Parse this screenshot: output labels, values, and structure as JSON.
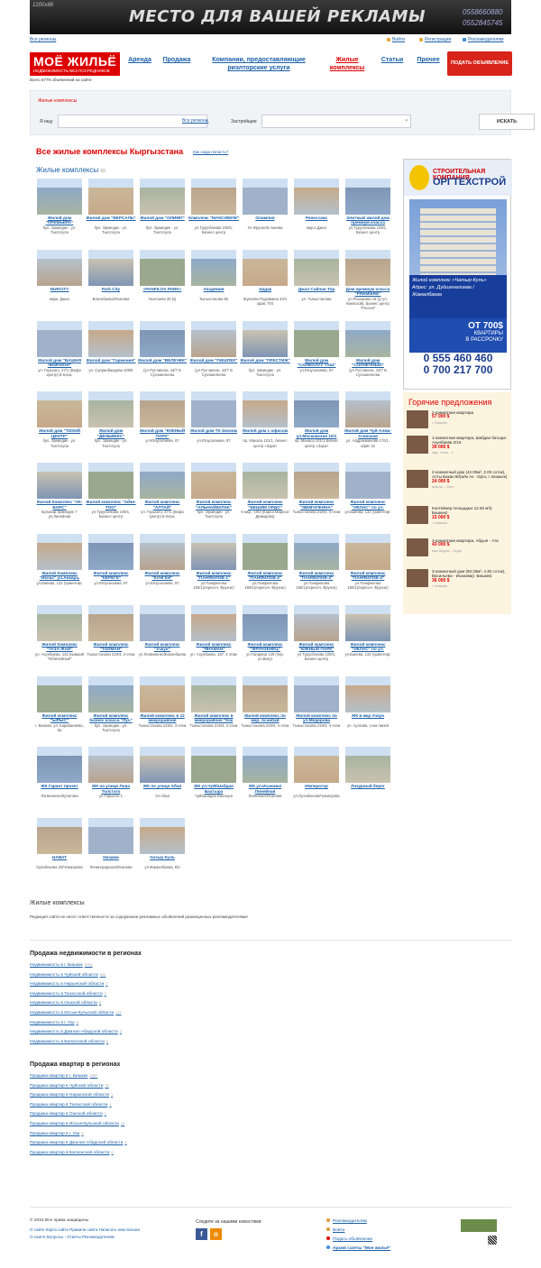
{
  "banner": {
    "dims": "1200x88",
    "text": "МЕСТО ДЛЯ ВАШЕЙ РЕКЛАМЫ",
    "phone1": "0558660880",
    "phone2": "0552845745"
  },
  "toplinks": {
    "regions": "Все регионы",
    "login": "Войти",
    "register": "Регистрация",
    "advertisers": "Рекламодателям"
  },
  "logo": {
    "title": "МОЁ ЖИЛЬЁ",
    "subtitle": "НЕДВИЖИМОСТЬ БЕЗ ПОСРЕДНИКОВ"
  },
  "count": "Всего 6779 объявлений на сайте",
  "nav": {
    "rent": "Аренда",
    "sale": "Продажа",
    "companies": "Компании, предоставляющие риэлторские услуги",
    "complexes": "Жилые комплексы",
    "articles": "Статьи",
    "other": "Прочее",
    "post": "ПОДАТЬ ОБЪЯВЛЕНИЕ"
  },
  "search": {
    "crumb": "Жилые комплексы",
    "ilook": "Я ищу",
    "all_regions": "Все регионы",
    "developer": "Застройщик:",
    "button": "ИСКАТЬ"
  },
  "heading": "Все жилые комплексы Кыргызстана",
  "howto": "Как сюда попасть?",
  "subheading": "Жилые комплексы",
  "subcount": "65",
  "complexes": [
    {
      "name": "Жилой дом \"ПРЕМЬЕРА\"",
      "addr": "бул. Эркиндик - ул. Тыктогула"
    },
    {
      "name": "Жилой дом \"ВЕРСАЛЬ\"",
      "addr": "бул. Эркиндик - ул. Тыктогула"
    },
    {
      "name": "Жилой дом \"ОЛИМП\"",
      "addr": "бул. Эркиндик - ул. Тыктогула"
    },
    {
      "name": "Комплекс \"МАКСИМУМ\"",
      "addr": "ул.Турусбекова 109/1, Бизнес центр"
    },
    {
      "name": "Олимпия",
      "addr": "Ул.Фрунзе/К.Акиева"
    },
    {
      "name": "Ренессанс",
      "addr": "мкр.н.Джал"
    },
    {
      "name": "Элитный жилой дом премиум класса",
      "addr": "ул.Турусбекова 109/1, Бизнес центр"
    },
    {
      "name": "NURCITY",
      "addr": "мкрн. Джал"
    },
    {
      "name": "Park City",
      "addr": "Боконбаева/Исанова"
    },
    {
      "name": "«PANFILOV PARK»",
      "addr": "Ушетаева 39 (к)"
    },
    {
      "name": "Академия",
      "addr": "Тыныстанова 86"
    },
    {
      "name": "Ардак",
      "addr": "Жукеева-Пудовкина 44/1 офис 704"
    },
    {
      "name": "Джал Сайпан Тор",
      "addr": "ул. Тыныстанова"
    },
    {
      "name": "Дом премиум класса \"PREMIERE\"",
      "addr": "ул.Раззакова 19 (уг.ул. Киевской), Бизнес центр \"Россия\""
    },
    {
      "name": "Жилой дом \"БАШНЯ ЧЕМПИОН\"",
      "addr": "ул. Горького, 27/1 (Вефа Центр) Б Блок,"
    },
    {
      "name": "Жилой дом \"Гармония\"",
      "addr": "ул. Суеранбаедова 109/6"
    },
    {
      "name": "Жилой дом \"ВЕЛЕЧЕК\"",
      "addr": "(ул Руставели, 43/7 Б Сухэмилеева"
    },
    {
      "name": "Жилой дом \"ПИШПЕК\"",
      "addr": "(ул Руставели, 43/7 Б Сухэмилеева"
    },
    {
      "name": "Жилой дом \"ПРЕСТИЖ\"",
      "addr": "бул. Эркиндик - ул. Тыктогула"
    },
    {
      "name": "Жилой дом \"САЙМАЛУУ ТАШ\"",
      "addr": "ул.Юнусалиева, 97"
    },
    {
      "name": "Жилой дом \"СОЛНЕЧНЫЙ\"",
      "addr": "(ул Руставели, 43/7 Б Сухэмилеева"
    },
    {
      "name": "Жилой дом \"ТИХИЙ ЦЕНТР\"",
      "addr": "бул. Эркиндик - ул. Тыктогула"
    },
    {
      "name": "Жилой дом \"ДЕНЬВЕКС\"",
      "addr": "бул. Эркиндик - ул. Тыктогула"
    },
    {
      "name": "Жилой дом \"ЮЖНЫЙ ПАРК\"",
      "addr": "ул.Юнусалиева, 97"
    },
    {
      "name": "Жилой дом ТК-Экоком",
      "addr": "ул.Юнусалиева, 97"
    },
    {
      "name": "Жилой дом с офисом",
      "addr": "пр. Манаса 101/1, бизнес центр «Зарат"
    },
    {
      "name": "Жилой дом ул.Московская 10/1",
      "addr": "пр. Манаса 101/1 Бизнес центр «Зарат"
    },
    {
      "name": "Жилой дом Чуй-Алма-Атинская",
      "addr": "ул. Абдрахманова 170/1, офис 16"
    },
    {
      "name": "Жилой Комплекс \"АК-БАРС\"",
      "addr": "Бульвар Эркиндик 'г' ул.Линейная"
    },
    {
      "name": "Жилой комплекс \"АЙЫ-ТОО\"",
      "addr": "ул.Турусбекова 109/1, Бизнес центр"
    },
    {
      "name": "Жилой комплекс \"АЛТАЙ\"",
      "addr": "ул. Горького, 27/1 (Вефа Центр) Б Блок,"
    },
    {
      "name": "Жилой комплекс \"АЛЬНАЙБУЛАК\"",
      "addr": "бул. Эркиндик - ул. Тыктогула"
    },
    {
      "name": "Жилой комплекс \"БЕШИМ ОРДО\"",
      "addr": "5 мкр., 10/3 (Карла Маркса/Демидова)"
    },
    {
      "name": "Жилой комплекс \"ЖЕМЧУЖИНА\"",
      "addr": "Тыныстанова 219/4, 4-этаж"
    },
    {
      "name": "Жилой комплекс \"ИКЛАС\" по ул.",
      "addr": "ул.Баяева, 132 (ориентир:"
    },
    {
      "name": "Жилой Комплекс \"Иклас\" ул.Анкара,",
      "addr": "ул.Баяева, 132 (ориентир:"
    },
    {
      "name": "Жилой комплекс \"КЕРЕГЕ\"",
      "addr": "ул.Юнусалиева, 97"
    },
    {
      "name": "Жилой комплекс \"КУНГЕЙ\"",
      "addr": "ул.Юнусалиева, 97"
    },
    {
      "name": "Жилой комплекс \"ПАНФИЛОВ-1\"",
      "addr": "ул.Панфилова 190/1(пересеч. Фрунзе)"
    },
    {
      "name": "Жилой комплекс \"ПАНФИЛОВ-2\"",
      "addr": "ул.Панфилова 190/1(пересеч. Фрунзе)"
    },
    {
      "name": "Жилой комплекс \"ПАНФИЛОВ-3\"",
      "addr": "ул.Панфилова 190/1(пересеч. Фрунзе)"
    },
    {
      "name": "Жилой комплекс \"ПАНФИЛОВ-4\"",
      "addr": "ул.Панфилова 190/1(пересеч. Фрунзе)"
    },
    {
      "name": "Жилой Комплекс \"ТАЗА-ЖАЙ\"",
      "addr": "ул. Ахунбаева, 132 Бывший \"Юбилейный\""
    },
    {
      "name": "Жилой комплекс \"ТОЛМАН\"",
      "addr": "Тыныстанова 219/4, 4-этаж"
    },
    {
      "name": "Жилой комплекс \"Учкун\"",
      "addr": "ул.Логвиненко/Боконбаева"
    },
    {
      "name": "Жилой комплекс \"ЯНАМАН\"",
      "addr": "ул. Ахунбаева, 187, 4 этаж"
    },
    {
      "name": "Жилой комплекс \"ФРУНЗЕНЕЦ\"",
      "addr": "ул.Гагарина 139 (пер. ул.Вагу)"
    },
    {
      "name": "Жилой комплекс \"ЮЖНЫЙ ПАРК\"",
      "addr": "ул.Турусбекова 109/1, Бизнес-центр"
    },
    {
      "name": "Жилой комплекс \"ИКЛАС\" по ул.",
      "addr": "ул.Баяева, 132 (ориентир:"
    },
    {
      "name": "Жилой комплекс \"ЫРЫС\"",
      "addr": "г. Бишкек, ул. Карабаевова, 5а"
    },
    {
      "name": "Жилой комплекс бизнес класса \"Луч\"",
      "addr": "бул. Эркиндик - ул. Тыктогула"
    },
    {
      "name": "Жилой комплекс в 12 микрорайоне",
      "addr": "Тыныстанова 219/4, 4-этаж"
    },
    {
      "name": "Жилой комплекс в микрорайоне \"Кок",
      "addr": "Тыныстанова 219/4, 4-этаж"
    },
    {
      "name": "Жилой комплекс по мкр. Асанбай",
      "addr": "Тыныстанова 219/4, 4-этаж"
    },
    {
      "name": "Жилой комплекс по ул.Медерова",
      "addr": "Тыныстанова 219/4, 4-этаж"
    },
    {
      "name": "ЖК в мкр Учкун",
      "addr": "ул. Ауэзова, 1-км линия"
    },
    {
      "name": "ЖК Гарант проект",
      "addr": "Логвиненко/Кулатова"
    },
    {
      "name": "ЖК на улице Льва Толстого",
      "addr": "ул.Горького 1"
    },
    {
      "name": "ЖК по улице Абая",
      "addr": "Ул.Абая"
    },
    {
      "name": "ЖК ул.Чуй/Шабдан Баатыра",
      "addr": "Чуй/Шабдан Баатыра"
    },
    {
      "name": "ЖК ул.Исанова/Линейная",
      "addr": "Линейная/Исанова"
    },
    {
      "name": "Император",
      "addr": "ул.Орозбекова/Чокморова"
    },
    {
      "name": "Лазурный берег",
      "addr": ""
    },
    {
      "name": "НАВАТ",
      "addr": "Орозбекова 20/Чокморова"
    },
    {
      "name": "Низами",
      "addr": "Ленинградская/Исанова"
    },
    {
      "name": "Чатыр Куль",
      "addr": "ул.Жамалбаева, 6/2"
    }
  ],
  "ad": {
    "company1": "СТРОИТЕЛЬНАЯ КОМПАНИЯ",
    "company2": "ОРГТЕХСТРОЙ",
    "line1": "Жилой комплекс «Чатыр-Куль»",
    "line2": "Адрес: ул. Дуйшеналиева / Жамалбаева",
    "price": "ОТ 700$",
    "price2": "КВАРТИРЫ",
    "price3": "В РАССРОЧКУ",
    "phone1": "0 555 460 460",
    "phone2": "0 700 217 700"
  },
  "hot": {
    "title": "Горячие предложения",
    "items": [
      {
        "title": "2-комнатная квартира",
        "price": "57 000 $",
        "loc": "г. Бишкек"
      },
      {
        "title": "1-комнатная квартира, Шабдан батыра-Ахунбаева 2/15",
        "price": "39 000 $",
        "loc": "мкр. Улан - 2"
      },
      {
        "title": "2-комнатный дом (42.00м², 2.00 соток), Алты Бакан 60(ж/м Ак - Орго, г. Бишкек)",
        "price": "24 000 $",
        "loc": "ж/м Ак - Орго"
      },
      {
        "title": "Контейнер площадью 12.50 м²(г. Бишкек)",
        "price": "15 000 $",
        "loc": "г. Бишкек"
      },
      {
        "title": "3-комнатная квартира, Абдыя - Ата",
        "price": "43 000 $",
        "loc": "мкр.Мурас - Ордо"
      },
      {
        "title": "3-комнатный дом (50.20м², 4.30 соток), Васильева - Исанова(г. Бишкек)",
        "price": "36 000 $",
        "loc": "г. Бишкек"
      }
    ]
  },
  "section": {
    "title": "Жилые комплексы",
    "disclaimer": "Редакция сайта не несет ответственности за содержание рекламных объявлений размещенных рекламодателями!"
  },
  "regions_sale": {
    "title": "Продажа недвижимости в регионах",
    "items": [
      {
        "label": "Недвижимость в г. Бишкек",
        "count": "3781"
      },
      {
        "label": "Недвижимость в Чуйской области",
        "count": "844"
      },
      {
        "label": "Недвижимость в Нарынской области",
        "count": "2"
      },
      {
        "label": "Недвижимость в Таласской области",
        "count": "2"
      },
      {
        "label": "Недвижимость в Ошской области",
        "count": "8"
      },
      {
        "label": "Недвижимость в Иссык-Кульской области",
        "count": "112"
      },
      {
        "label": "Недвижимость в г. Ош",
        "count": "8"
      },
      {
        "label": "Недвижимость в Джалал-Абадской области",
        "count": "2"
      },
      {
        "label": "Недвижимость в Баткенской области",
        "count": "0"
      }
    ]
  },
  "regions_flats": {
    "title": "Продажа квартир в регионах",
    "items": [
      {
        "label": "Продажа квартир в г. Бишкек",
        "count": "1557"
      },
      {
        "label": "Продажа квартир в Чуйской области",
        "count": "76"
      },
      {
        "label": "Продажа квартир в Нарынской области",
        "count": "1"
      },
      {
        "label": "Продажа квартир в Таласской области",
        "count": "1"
      },
      {
        "label": "Продажа квартир в Ошской области",
        "count": "1"
      },
      {
        "label": "Продажа квартир в Иссык-Кульской области",
        "count": "13"
      },
      {
        "label": "Продажа квартир в г. Ош",
        "count": "3"
      },
      {
        "label": "Продажа квартир в Джалал-Абадской области",
        "count": "1"
      },
      {
        "label": "Продажа квартир в Баткенской области",
        "count": "0"
      }
    ]
  },
  "footer": {
    "copy": "© 2015 Все права защищены",
    "links1": "О сайте   Карта сайта   Правила сайта   Написать нам письмо",
    "links2": "О газете   Вопросы - Ответы   Рекламодателям",
    "follow": "Следите за нашими новостями:",
    "fb": "f",
    "ok": "о",
    "r1": "Рекламодателям",
    "r2": "Войти",
    "r3": "Подать объявление",
    "r4": "Архив газеты \"Мое жильё\""
  },
  "colors": {
    "accent": "#d00",
    "link": "#1a5fa8"
  }
}
